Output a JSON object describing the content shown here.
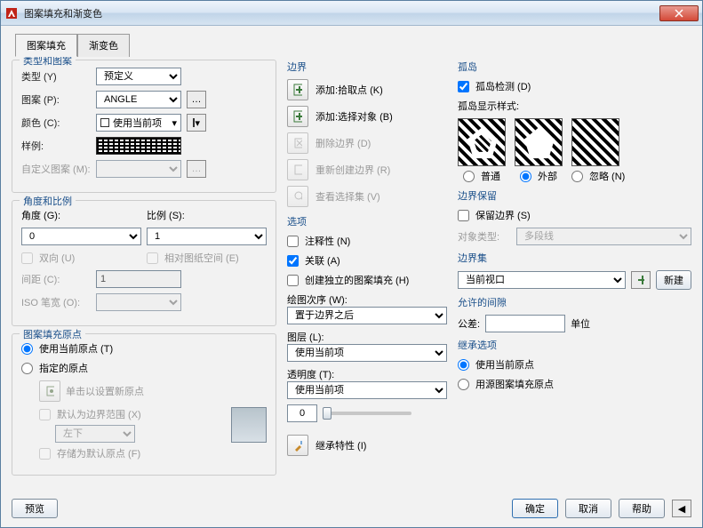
{
  "window": {
    "title": "图案填充和渐变色"
  },
  "tabs": {
    "hatch": "图案填充",
    "gradient": "渐变色"
  },
  "typePattern": {
    "title": "类型和图案",
    "typeLabel": "类型 (Y)",
    "typeValue": "预定义",
    "patternLabel": "图案 (P):",
    "patternValue": "ANGLE",
    "colorLabel": "颜色 (C):",
    "colorValue": "使用当前项",
    "sampleLabel": "样例:",
    "customLabel": "自定义图案 (M):"
  },
  "angleScale": {
    "title": "角度和比例",
    "angleLabel": "角度 (G):",
    "angleValue": "0",
    "scaleLabel": "比例 (S):",
    "scaleValue": "1",
    "doubleLabel": "双向 (U)",
    "relativeLabel": "相对图纸空间 (E)",
    "spacingLabel": "间距 (C):",
    "spacingValue": "1",
    "isoLabel": "ISO 笔宽 (O):"
  },
  "origin": {
    "title": "图案填充原点",
    "useCurrent": "使用当前原点 (T)",
    "specified": "指定的原点",
    "clickSet": "单击以设置新原点",
    "defaultBounds": "默认为边界范围 (X)",
    "positionValue": "左下",
    "storeDefault": "存储为默认原点 (F)"
  },
  "boundary": {
    "title": "边界",
    "addPick": "添加:拾取点 (K)",
    "addSelect": "添加:选择对象 (B)",
    "deleteBounds": "删除边界 (D)",
    "recreateBounds": "重新创建边界 (R)",
    "viewSelection": "查看选择集 (V)"
  },
  "options": {
    "title": "选项",
    "annotative": "注释性 (N)",
    "associative": "关联 (A)",
    "independent": "创建独立的图案填充 (H)",
    "drawOrderLabel": "绘图次序 (W):",
    "drawOrderValue": "置于边界之后",
    "layerLabel": "图层 (L):",
    "layerValue": "使用当前项",
    "transparencyLabel": "透明度 (T):",
    "transparencyValue": "使用当前项",
    "transparencyNum": "0"
  },
  "inheritProps": "继承特性 (I)",
  "islands": {
    "title": "孤岛",
    "detect": "孤岛检测 (D)",
    "styleLabel": "孤岛显示样式:",
    "normal": "普通",
    "outer": "外部",
    "ignore": "忽略 (N)"
  },
  "boundaryRetain": {
    "title": "边界保留",
    "retain": "保留边界 (S)",
    "objTypeLabel": "对象类型:",
    "objTypeValue": "多段线"
  },
  "boundarySet": {
    "title": "边界集",
    "value": "当前视口",
    "newBtn": "新建"
  },
  "gap": {
    "title": "允许的间隙",
    "toleranceLabel": "公差:",
    "toleranceValue": "",
    "unitLabel": "单位"
  },
  "inheritOpt": {
    "title": "继承选项",
    "useCurrent": "使用当前原点",
    "useSource": "用源图案填充原点"
  },
  "footer": {
    "preview": "预览",
    "ok": "确定",
    "cancel": "取消",
    "help": "帮助"
  }
}
